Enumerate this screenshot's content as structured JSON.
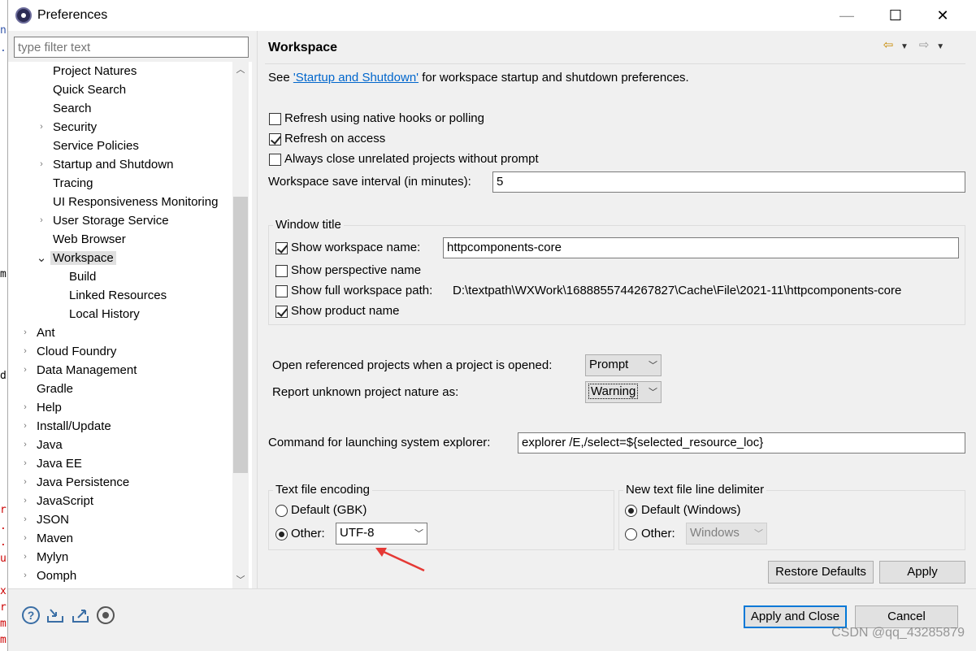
{
  "window": {
    "title": "Preferences",
    "minimize": "—",
    "maximize": "☐",
    "close": "✕"
  },
  "filter": {
    "placeholder": "type filter text"
  },
  "tree": {
    "items": [
      {
        "label": "Project Natures",
        "expander": ""
      },
      {
        "label": "Quick Search",
        "expander": ""
      },
      {
        "label": "Search",
        "expander": ""
      },
      {
        "label": "Security",
        "expander": "›"
      },
      {
        "label": "Service Policies",
        "expander": ""
      },
      {
        "label": "Startup and Shutdown",
        "expander": "›"
      },
      {
        "label": "Tracing",
        "expander": ""
      },
      {
        "label": "UI Responsiveness Monitoring",
        "expander": ""
      },
      {
        "label": "User Storage Service",
        "expander": "›"
      },
      {
        "label": "Web Browser",
        "expander": ""
      },
      {
        "label": "Workspace",
        "expander": "⌄",
        "selected": true
      },
      {
        "label": "Build",
        "expander": ""
      },
      {
        "label": "Linked Resources",
        "expander": ""
      },
      {
        "label": "Local History",
        "expander": ""
      },
      {
        "label": "Ant",
        "expander": "›"
      },
      {
        "label": "Cloud Foundry",
        "expander": "›"
      },
      {
        "label": "Data Management",
        "expander": "›"
      },
      {
        "label": "Gradle",
        "expander": ""
      },
      {
        "label": "Help",
        "expander": "›"
      },
      {
        "label": "Install/Update",
        "expander": "›"
      },
      {
        "label": "Java",
        "expander": "›"
      },
      {
        "label": "Java EE",
        "expander": "›"
      },
      {
        "label": "Java Persistence",
        "expander": "›"
      },
      {
        "label": "JavaScript",
        "expander": "›"
      },
      {
        "label": "JSON",
        "expander": "›"
      },
      {
        "label": "Maven",
        "expander": "›"
      },
      {
        "label": "Mylyn",
        "expander": "›"
      },
      {
        "label": "Oomph",
        "expander": "›"
      }
    ]
  },
  "page": {
    "title": "Workspace",
    "intro_prefix": "See ",
    "intro_link": "'Startup and Shutdown'",
    "intro_suffix": " for workspace startup and shutdown preferences.",
    "refresh_native": {
      "label": "Refresh using native hooks or polling",
      "checked": false
    },
    "refresh_access": {
      "label": "Refresh on access",
      "checked": true
    },
    "always_close": {
      "label": "Always close unrelated projects without prompt",
      "checked": false
    },
    "save_interval": {
      "label": "Workspace save interval (in minutes):",
      "value": "5"
    },
    "window_title": {
      "group_label": "Window title",
      "show_workspace_name": {
        "label": "Show workspace name:",
        "checked": true,
        "value": "httpcomponents-core"
      },
      "show_perspective_name": {
        "label": "Show perspective name",
        "checked": false
      },
      "show_full_path": {
        "label": "Show full workspace path:",
        "checked": false,
        "value": "D:\\textpath\\WXWork\\1688855744267827\\Cache\\File\\2021-11\\httpcomponents-core"
      },
      "show_product_name": {
        "label": "Show product name",
        "checked": true
      }
    },
    "open_referenced": {
      "label": "Open referenced projects when a project is opened:",
      "value": "Prompt"
    },
    "report_unknown": {
      "label": "Report unknown project nature as:",
      "value": "Warning"
    },
    "system_explorer": {
      "label": "Command for launching system explorer:",
      "value": "explorer /E,/select=${selected_resource_loc}"
    },
    "encoding": {
      "group_label": "Text file encoding",
      "default_label": "Default (GBK)",
      "other_label": "Other:",
      "other_value": "UTF-8",
      "selected": "other"
    },
    "delimiter": {
      "group_label": "New text file line delimiter",
      "default_label": "Default (Windows)",
      "other_label": "Other:",
      "other_value": "Windows",
      "selected": "default"
    },
    "restore_defaults": "Restore Defaults",
    "apply": "Apply"
  },
  "footer": {
    "apply_and_close": "Apply and Close",
    "cancel": "Cancel",
    "help_icon": "?"
  },
  "watermark": "CSDN @qq_43285879",
  "colors": {
    "accent": "#0078d7",
    "link": "#0066cc",
    "annotation_arrow": "#e53935"
  }
}
